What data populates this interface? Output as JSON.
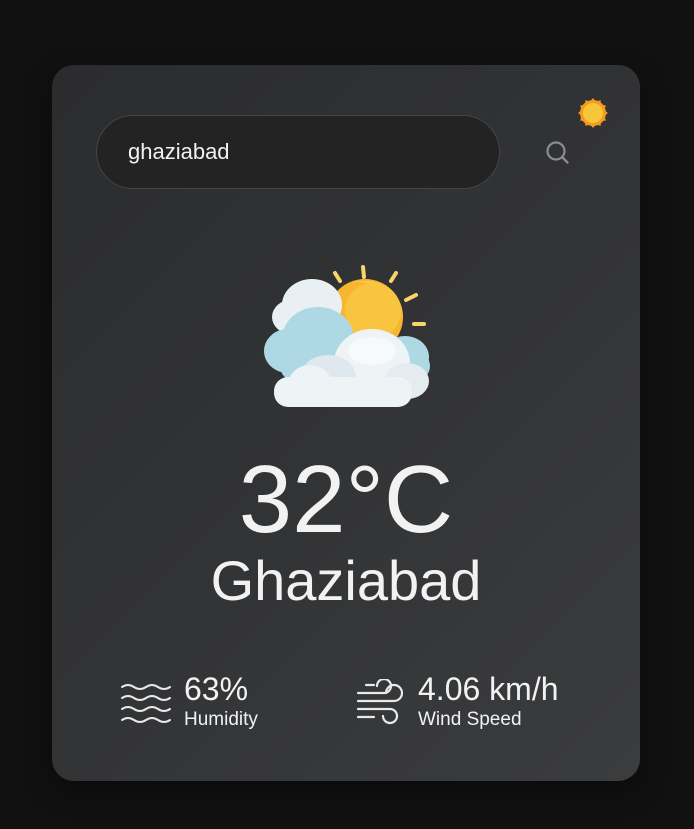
{
  "search": {
    "value": "ghaziabad",
    "placeholder": "",
    "button_icon": "search-icon"
  },
  "theme_toggle": {
    "icon": "sun-icon",
    "color": "#f5a623"
  },
  "weather": {
    "condition_icon": "partly-cloudy-icon",
    "temperature": "32°C",
    "city": "Ghaziabad"
  },
  "details": {
    "humidity": {
      "icon": "humidity-waves-icon",
      "value": "63%",
      "label": "Humidity"
    },
    "wind": {
      "icon": "wind-icon",
      "value": "4.06 km/h",
      "label": "Wind Speed"
    }
  }
}
